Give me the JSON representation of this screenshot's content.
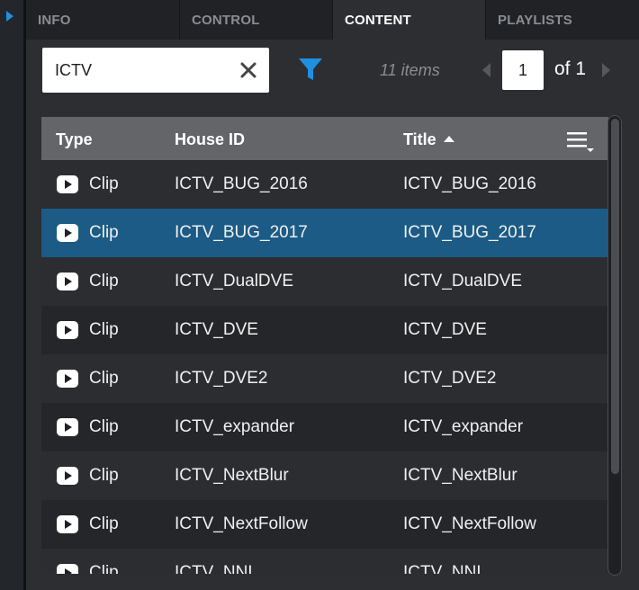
{
  "tabs": [
    {
      "label": "INFO",
      "active": false
    },
    {
      "label": "CONTROL",
      "active": false
    },
    {
      "label": "CONTENT",
      "active": true
    },
    {
      "label": "PLAYLISTS",
      "active": false
    }
  ],
  "search": {
    "value": "ICTV",
    "placeholder": ""
  },
  "toolbar": {
    "items_count": "11 items",
    "current_page": "1",
    "page_of": "of 1"
  },
  "table": {
    "headers": {
      "type": "Type",
      "house_id": "House ID",
      "title": "Title",
      "title_sort": "ascending"
    },
    "rows": [
      {
        "type": "Clip",
        "house_id": "ICTV_BUG_2016",
        "title": "ICTV_BUG_2016",
        "selected": false
      },
      {
        "type": "Clip",
        "house_id": "ICTV_BUG_2017",
        "title": "ICTV_BUG_2017",
        "selected": true
      },
      {
        "type": "Clip",
        "house_id": "ICTV_DualDVE",
        "title": "ICTV_DualDVE",
        "selected": false
      },
      {
        "type": "Clip",
        "house_id": "ICTV_DVE",
        "title": "ICTV_DVE",
        "selected": false
      },
      {
        "type": "Clip",
        "house_id": "ICTV_DVE2",
        "title": "ICTV_DVE2",
        "selected": false
      },
      {
        "type": "Clip",
        "house_id": "ICTV_expander",
        "title": "ICTV_expander",
        "selected": false
      },
      {
        "type": "Clip",
        "house_id": "ICTV_NextBlur",
        "title": "ICTV_NextBlur",
        "selected": false
      },
      {
        "type": "Clip",
        "house_id": "ICTV_NextFollow",
        "title": "ICTV_NextFollow",
        "selected": false
      },
      {
        "type": "Clip",
        "house_id": "ICTV_NNI",
        "title": "ICTV_NNI",
        "selected": false
      }
    ]
  },
  "icons": {
    "rail": "expand-arrow-icon",
    "clear": "close-icon",
    "filter": "filter-icon",
    "prev": "chevron-left-icon",
    "next": "chevron-right-icon",
    "columns": "column-menu-icon",
    "row_type": "play-icon"
  },
  "colors": {
    "accent": "#1f8fe0",
    "selected_row": "#1b5b85",
    "header_bg": "#636569",
    "panel_bg": "#2c2e32"
  }
}
